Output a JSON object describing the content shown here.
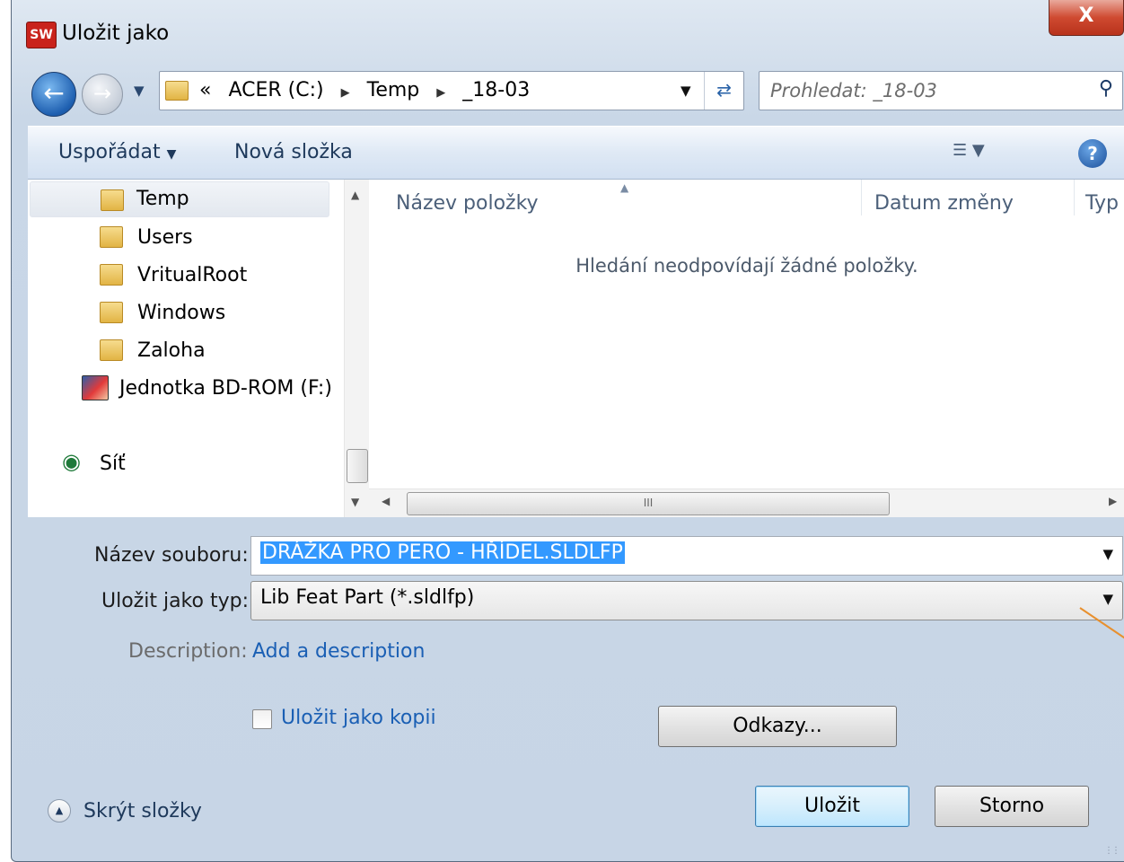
{
  "window": {
    "title": "Uložit jako",
    "app_icon": "SW",
    "close_label": "X"
  },
  "nav": {
    "back_icon": "back-arrow-icon",
    "forward_icon": "forward-arrow-icon",
    "address": {
      "prefix": "«",
      "crumbs": [
        "ACER (C:)",
        "Temp",
        "_18-03"
      ]
    },
    "search_placeholder": "Prohledat: _18-03"
  },
  "toolbar": {
    "organize_label": "Uspořádat",
    "new_folder_label": "Nová složka"
  },
  "tree": {
    "items": [
      {
        "label": "Temp",
        "icon": "folder-icon",
        "selected": true
      },
      {
        "label": "Users",
        "icon": "folder-icon"
      },
      {
        "label": "VritualRoot",
        "icon": "folder-icon"
      },
      {
        "label": "Windows",
        "icon": "folder-icon"
      },
      {
        "label": "Zaloha",
        "icon": "folder-icon"
      },
      {
        "label": "Jednotka BD-ROM (F:)",
        "icon": "drive-icon"
      },
      {
        "label": "Síť",
        "icon": "network-icon"
      }
    ]
  },
  "file_list": {
    "columns": [
      "Název položky",
      "Datum změny",
      "Typ"
    ],
    "empty_message": "Hledání neodpovídají žádné položky.",
    "scroll_grip": "III"
  },
  "form": {
    "filename_label": "Název souboru:",
    "filename_value": "DRÁŽKA PRO PERO - HŘÍDEL.SLDLFP",
    "type_label": "Uložit jako typ:",
    "type_value": "Lib Feat Part (*.sldlfp)",
    "description_label": "Description:",
    "description_link": "Add a description",
    "save_copy_label": "Uložit jako kopii",
    "save_copy_checked": false,
    "references_button": "Odkazy..."
  },
  "footer": {
    "hide_folders_label": "Skrýt složky",
    "save_button": "Uložit",
    "cancel_button": "Storno"
  },
  "colors": {
    "accent": "#3399ff",
    "link": "#1a5fb4",
    "close_red": "#cf4a31",
    "annotation_orange": "#e8902e"
  }
}
